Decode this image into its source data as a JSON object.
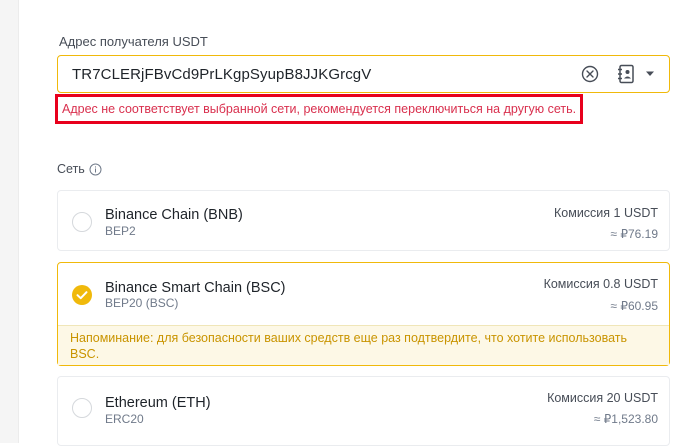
{
  "address": {
    "label": "Адрес получателя USDT",
    "value": "TR7CLERjFBvCd9PrLKgpSyupB8JJKGrcgV",
    "icons": [
      "clear-circle-icon",
      "address-book-icon",
      "dropdown-arrow-icon"
    ]
  },
  "error": {
    "message": "Адрес не соответствует выбранной сети, рекомендуется переключиться на другую сеть.",
    "color": "#d9304e",
    "highlight_color": "#e8001c"
  },
  "network": {
    "label": "Сеть",
    "info_icon": "info-icon",
    "options": [
      {
        "name": "Binance Chain (BNB)",
        "sub": "BEP2",
        "fee": "Комиссия 1 USDT",
        "approx": "≈ ₽76.19",
        "selected": false
      },
      {
        "name": "Binance Smart Chain (BSC)",
        "sub": "BEP20 (BSC)",
        "fee": "Комиссия 0.8 USDT",
        "approx": "≈ ₽60.95",
        "selected": true,
        "reminder": "Напоминание: для безопасности ваших средств еще раз подтвердите, что хотите использовать BSC."
      },
      {
        "name": "Ethereum (ETH)",
        "sub": "ERC20",
        "fee": "Комиссия 20 USDT",
        "approx": "≈ ₽1,523.80",
        "selected": false
      }
    ]
  },
  "colors": {
    "accent": "#f0b90b",
    "reminder_text": "#c99400",
    "reminder_bg": "#fdf8e6"
  }
}
